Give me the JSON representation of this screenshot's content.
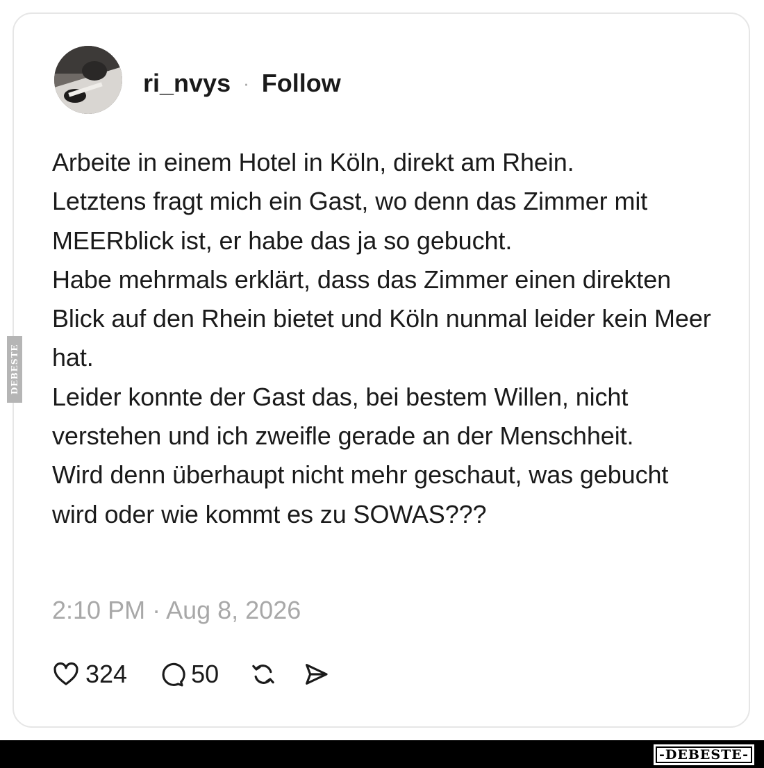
{
  "post": {
    "username": "ri_nvys",
    "separator": "·",
    "follow_label": "Follow",
    "body": "Arbeite in einem Hotel in Köln, direkt am Rhein.\nLetztens fragt mich ein Gast, wo denn das Zimmer mit MEERblick ist, er habe das ja so gebucht.\nHabe mehrmals erklärt, dass das Zimmer einen direkten Blick auf den Rhein bietet und Köln nunmal leider kein Meer hat.\nLeider konnte der Gast das, bei bestem Willen, nicht verstehen und ich zweifle gerade an der Menschheit.\nWird denn überhaupt nicht mehr geschaut, was gebucht wird oder wie kommt es zu SOWAS???",
    "timestamp": "2:10 PM · Aug 8, 2026"
  },
  "actions": {
    "like_icon": "heart-icon",
    "like_count": "324",
    "reply_icon": "comment-bubble-icon",
    "reply_count": "50",
    "repost_icon": "repost-icon",
    "share_icon": "send-icon"
  },
  "watermark": {
    "side_text": "DEBESTE",
    "footer_text": "-DEBESTE-"
  }
}
